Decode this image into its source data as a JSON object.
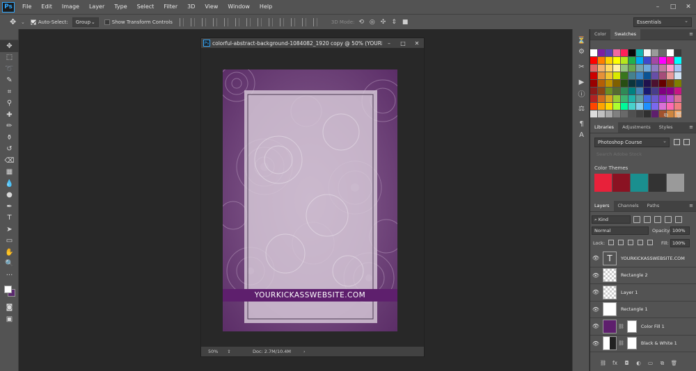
{
  "app": {
    "logo": "Ps"
  },
  "menu": [
    "File",
    "Edit",
    "Image",
    "Layer",
    "Type",
    "Select",
    "Filter",
    "3D",
    "View",
    "Window",
    "Help"
  ],
  "window_controls": [
    "–",
    "□",
    "✕"
  ],
  "options_bar": {
    "auto_select_label": "Auto-Select:",
    "auto_select_value": "Group",
    "show_transform_label": "Show Transform Controls",
    "mode_3d_label": "3D Mode:",
    "workspace": "Essentials"
  },
  "document": {
    "title": "colorful-abstract-background-1084082_1920 copy @ 50% (YOURKICK...",
    "zoom": "50%",
    "doc_info": "Doc: 2.7M/10.4M",
    "banner_text": "YOURKICKASSWEBSITE.COM"
  },
  "swatches_panel": {
    "tabs": [
      "Color",
      "Swatches"
    ],
    "active_tab": "Swatches",
    "colors": [
      [
        "#ffffff",
        "#7a1fa2",
        "#5a3fb0",
        "#f06aa0",
        "#ff1f5a",
        "#0a0a0a",
        "#12b4b4",
        "#f5f5f5",
        "#9a9a9a",
        "#6a6a6a",
        "#ffffff",
        "#3a3a3a"
      ],
      [
        "#ff0000",
        "#ff7f00",
        "#ffd400",
        "#ffff00",
        "#b5e61d",
        "#22b14c",
        "#00a8f3",
        "#3f48cc",
        "#a349a4",
        "#ff00ff",
        "#ff1493",
        "#00ffff"
      ],
      [
        "#e06666",
        "#f6b26b",
        "#ffd966",
        "#fff2a8",
        "#93c47d",
        "#6aa84f",
        "#76a5af",
        "#6fa8dc",
        "#8e7cc3",
        "#c27ba0",
        "#ff99cc",
        "#a4c2f4"
      ],
      [
        "#cc0000",
        "#e69138",
        "#f1c232",
        "#d9ea00",
        "#38761d",
        "#45818e",
        "#3d85c6",
        "#0b5394",
        "#674ea7",
        "#a64d79",
        "#ea9999",
        "#cfe2f3"
      ],
      [
        "#990000",
        "#b45f06",
        "#bf9000",
        "#7f6000",
        "#274e13",
        "#0c343d",
        "#073763",
        "#20124d",
        "#4c1130",
        "#660000",
        "#783f04",
        "#7f7f00"
      ],
      [
        "#8b1a1a",
        "#8b4513",
        "#6b8e23",
        "#556b2f",
        "#2e8b57",
        "#008080",
        "#4682b4",
        "#191970",
        "#483d8b",
        "#800080",
        "#8b008b",
        "#c71585"
      ],
      [
        "#b22222",
        "#d2691e",
        "#daa520",
        "#9acd32",
        "#3cb371",
        "#20b2aa",
        "#5f9ea0",
        "#4169e1",
        "#6a5acd",
        "#9932cc",
        "#ba55d3",
        "#db7093"
      ],
      [
        "#ff4500",
        "#ffa500",
        "#ffd700",
        "#adff2f",
        "#00fa9a",
        "#48d1cc",
        "#87ceeb",
        "#1e90ff",
        "#7b68ee",
        "#da70d6",
        "#ff69b4",
        "#f08080"
      ],
      [
        "#dcdcdc",
        "#c0c0c0",
        "#a9a9a9",
        "#808080",
        "#696969",
        "#505050",
        "#404040",
        "#303030",
        "#5e1f6d",
        "#a0522d",
        "#cd853f",
        "#f4a460"
      ]
    ]
  },
  "libraries_panel": {
    "tabs": [
      "Libraries",
      "Adjustments",
      "Styles"
    ],
    "active_tab": "Libraries",
    "library": "Photoshop Course",
    "search_placeholder": "Search Adobe Stock",
    "color_themes_label": "Color Themes",
    "color_themes": [
      "#e8213a",
      "#8a1222",
      "#1a8f8f",
      "#333333",
      "#9a9a9a"
    ]
  },
  "layers_panel": {
    "tabs": [
      "Layers",
      "Channels",
      "Paths"
    ],
    "active_tab": "Layers",
    "filter_kind": "Kind",
    "blend_mode": "Normal",
    "opacity_label": "Opacity:",
    "opacity": "100%",
    "lock_label": "Lock:",
    "fill_label": "Fill:",
    "fill": "100%",
    "layers": [
      {
        "name": "YOURKICKASSWEBSITE.COM",
        "thumb": "text",
        "mask": false
      },
      {
        "name": "Rectangle 2",
        "thumb": "check",
        "mask": false
      },
      {
        "name": "Layer 1",
        "thumb": "check",
        "mask": false
      },
      {
        "name": "Rectangle 1",
        "thumb": "white",
        "mask": false
      },
      {
        "name": "Color Fill 1",
        "thumb": "purple",
        "mask": true
      },
      {
        "name": "Black & White 1",
        "thumb": "bw",
        "mask": true
      }
    ]
  }
}
